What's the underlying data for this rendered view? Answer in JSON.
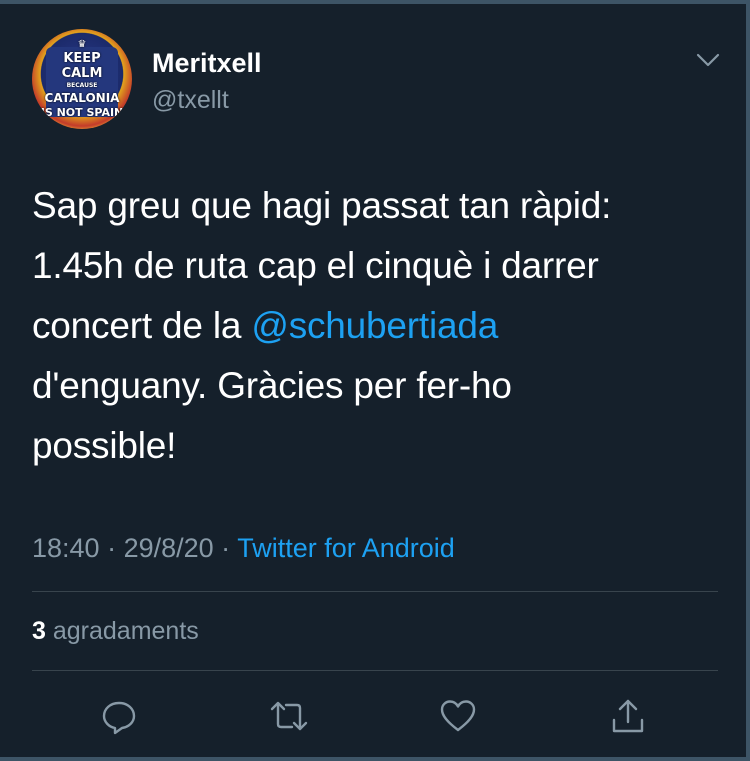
{
  "tweet": {
    "author": {
      "name": "Meritxell",
      "handle": "@txellt",
      "avatar_text": {
        "line1": "KEEP",
        "line2": "CALM",
        "line3": "BECAUSE",
        "line4": "CATALONIA",
        "line5": "IS NOT SPAIN"
      }
    },
    "text_lines": [
      "Sap greu que hagi passat tan ràpid:",
      "1.45h de ruta cap el cinquè i darrer",
      "concert de la ",
      "d'enguany. Gràcies per fer-ho",
      "possible!"
    ],
    "mention": "@schubertiada",
    "time": "18:40",
    "separator": " · ",
    "date": "29/8/20",
    "source": "Twitter for Android",
    "likes_count": "3",
    "likes_label": " agradaments"
  },
  "icons": {
    "menu": "chevron-down-icon",
    "reply": "reply-icon",
    "retweet": "retweet-icon",
    "like": "heart-icon",
    "share": "share-icon"
  },
  "colors": {
    "background": "#15202b",
    "accent": "#1da1f2",
    "secondary_text": "#8899a6",
    "divider": "#38444d"
  }
}
